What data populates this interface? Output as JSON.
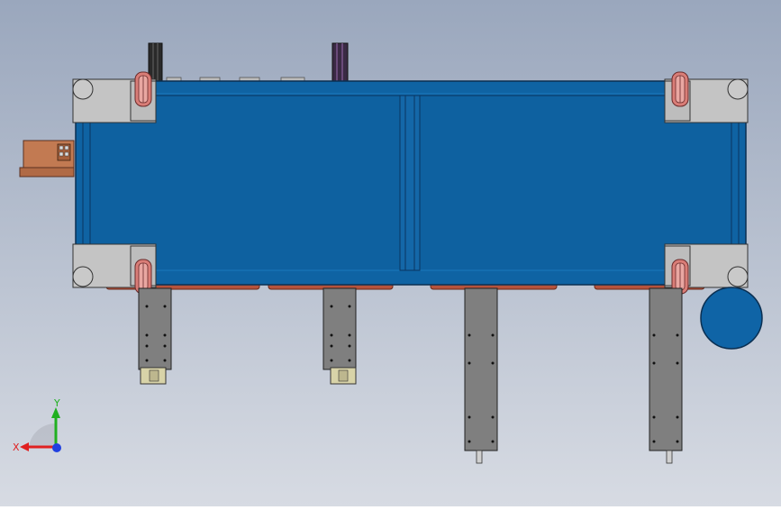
{
  "viewport": {
    "background_top": "#9aa7bd",
    "background_bottom": "#d7dbe3",
    "frame_color": "#0f63a3",
    "plate_color": "#c4c4c4",
    "bracket_color": "#d07a73",
    "leg_color": "#7f7f7f",
    "motor_color": "#0f64a6"
  },
  "triad": {
    "x_label": "X",
    "y_label": "Y",
    "x_color": "#e02020",
    "y_color": "#20b020",
    "z_color": "#2040e0"
  }
}
